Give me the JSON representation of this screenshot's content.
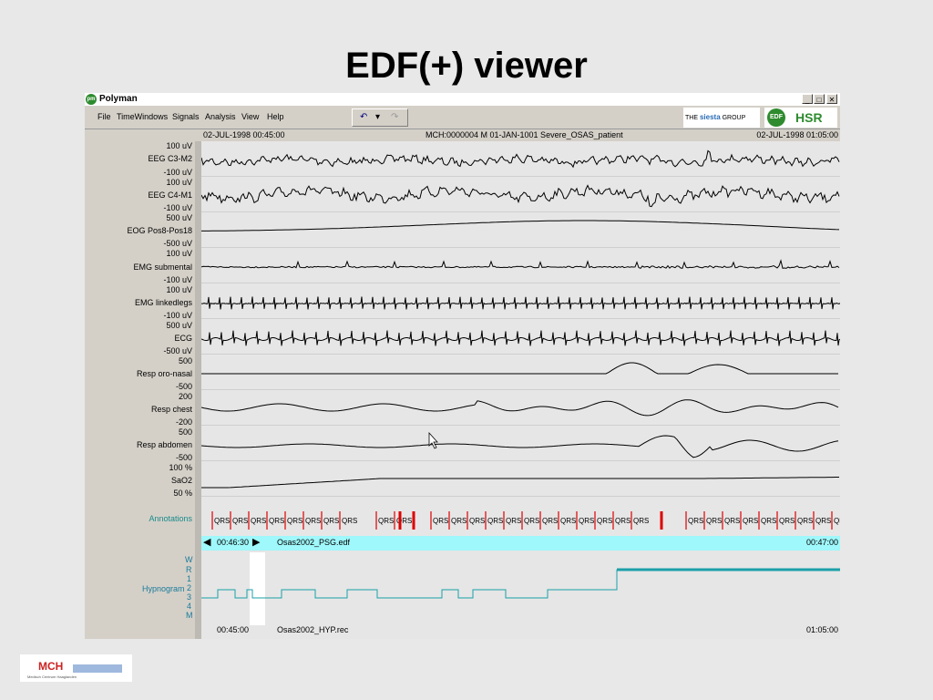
{
  "slide": {
    "title": "EDF(+) viewer"
  },
  "window": {
    "app_title": "Polyman",
    "app_icon_glyph": "pm",
    "buttons": {
      "minimize": "_",
      "maximize": "□",
      "close": "✕"
    }
  },
  "menu": [
    "File",
    "TimeWindows",
    "Signals",
    "Analysis",
    "View",
    "Help"
  ],
  "toolbar": {
    "undo_glyph": "↶",
    "dropdown_glyph": "▾",
    "redo_glyph": "↷"
  },
  "logos": {
    "siesta_prefix": "THE",
    "siesta_name": "siesta",
    "siesta_suffix": "GROUP",
    "edf_badge": "EDF",
    "hsr": "HSR"
  },
  "header": {
    "start_time": "02-JUL-1998 00:45:00",
    "patient": "MCH:0000004 M 01-JAN-1001 Severe_OSAS_patient",
    "end_time": "02-JUL-1998 01:05:00"
  },
  "channels": [
    {
      "name": "EEG C3-M2",
      "top": "100 uV",
      "bottom": "-100 uV"
    },
    {
      "name": "EEG C4-M1",
      "top": "100 uV",
      "bottom": "-100 uV"
    },
    {
      "name": "EOG Pos8-Pos18",
      "top": "500 uV",
      "bottom": "-500 uV"
    },
    {
      "name": "EMG submental",
      "top": "100 uV",
      "bottom": "-100 uV"
    },
    {
      "name": "EMG linkedlegs",
      "top": "100 uV",
      "bottom": "-100 uV"
    },
    {
      "name": "ECG",
      "top": "500 uV",
      "bottom": "-500 uV"
    },
    {
      "name": "Resp oro-nasal",
      "top": "500",
      "bottom": "-500"
    },
    {
      "name": "Resp chest",
      "top": "200",
      "bottom": "-200"
    },
    {
      "name": "Resp abdomen",
      "top": "500",
      "bottom": "-500"
    },
    {
      "name": "SaO2",
      "top": "100 %",
      "bottom": "50 %"
    }
  ],
  "annotations": {
    "label": "Annotations",
    "marker_text": "QRS"
  },
  "timebar": {
    "left_arrow": "◀",
    "cursor_time": "00:46:30",
    "right_arrow": "▶",
    "file": "Osas2002_PSG.edf",
    "end": "00:47:00"
  },
  "hypnogram": {
    "label": "Hypnogram",
    "stages": [
      "W",
      "R",
      "1",
      "2",
      "3",
      "4",
      "M"
    ]
  },
  "bottom": {
    "start": "00:45:00",
    "file": "Osas2002_HYP.rec",
    "end": "01:05:00"
  },
  "footer_logo": {
    "name": "MCH",
    "subtitle": "Medisch Centrum Haaglanden"
  },
  "colors": {
    "annotation_red": "#dd0000",
    "hypnogram_teal": "#1aa0a8",
    "timebar_cyan": "#9ff8fb",
    "signal": "#000000"
  }
}
